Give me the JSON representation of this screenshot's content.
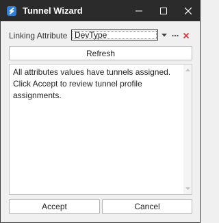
{
  "window": {
    "title": "Tunnel Wizard",
    "controls": {
      "minimize": "minimize-icon",
      "maximize": "maximize-icon",
      "close": "close-icon"
    }
  },
  "linking": {
    "label": "Linking Attribute",
    "value": "DevType",
    "buttons": [
      "dropdown-arrow-icon",
      "ellipsis-icon",
      "clear-icon"
    ]
  },
  "refresh_button": "Refresh",
  "message": {
    "line1": "All attributes values have tunnels assigned.",
    "line2": "Click Accept to review tunnel profile assignments."
  },
  "footer": {
    "accept_label": "Accept",
    "cancel_label": "Cancel"
  },
  "colors": {
    "titlebar": "#2b2b2b",
    "window_bg": "#f0f0f0",
    "clear_icon": "#d9363e",
    "app_icon": "#2f7fd8"
  }
}
